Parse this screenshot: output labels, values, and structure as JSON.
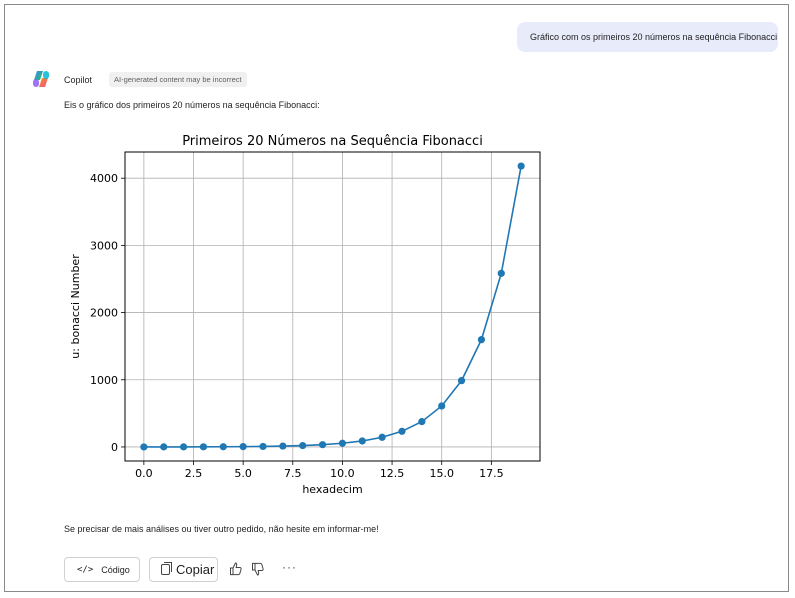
{
  "user_message": "Gráfico com os primeiros 20 números na sequência Fibonacci",
  "assistant": {
    "name": "Copilot",
    "badge": "AI-generated content may be incorrect",
    "intro": "Eis o gráfico dos primeiros 20 números na sequência Fibonacci:",
    "outro": "Se precisar de mais análises ou tiver outro pedido, não hesite em informar-me!"
  },
  "actions": {
    "code_label": "Código",
    "copy_label": "Copiar"
  },
  "icons": {
    "logo": "copilot-logo-icon",
    "code": "code-icon",
    "copy": "copy-icon",
    "like": "thumbs-up-icon",
    "dislike": "thumbs-down-icon",
    "more": "more-icon"
  },
  "colors": {
    "series": "#1f77b4",
    "user_bubble": "#e8ebfa"
  },
  "chart_data": {
    "type": "line",
    "title": "Primeiros 20 Números na Sequência Fibonacci",
    "xlabel": "hexadecim",
    "ylabel": "u: bonacci Number",
    "x": [
      0,
      1,
      2,
      3,
      4,
      5,
      6,
      7,
      8,
      9,
      10,
      11,
      12,
      13,
      14,
      15,
      16,
      17,
      18,
      19
    ],
    "series": [
      {
        "values": [
          0,
          1,
          1,
          2,
          3,
          5,
          8,
          13,
          21,
          34,
          55,
          89,
          144,
          233,
          377,
          610,
          987,
          1597,
          2584,
          4181
        ]
      }
    ],
    "xlim": [
      -0.95,
      19.95
    ],
    "ylim": [
      -209,
      4390
    ],
    "xticks": [
      0.0,
      2.5,
      5.0,
      7.5,
      10.0,
      12.5,
      15.0,
      17.5
    ],
    "xtick_labels": [
      "0.0",
      "2.5",
      "5.0",
      "7.5",
      "10.0",
      "12.5",
      "15.0",
      "17.5"
    ],
    "yticks": [
      0,
      1000,
      2000,
      3000,
      4000
    ],
    "ytick_labels": [
      "0",
      "1000",
      "2000",
      "3000",
      "4000"
    ],
    "grid": true,
    "markers": true
  }
}
